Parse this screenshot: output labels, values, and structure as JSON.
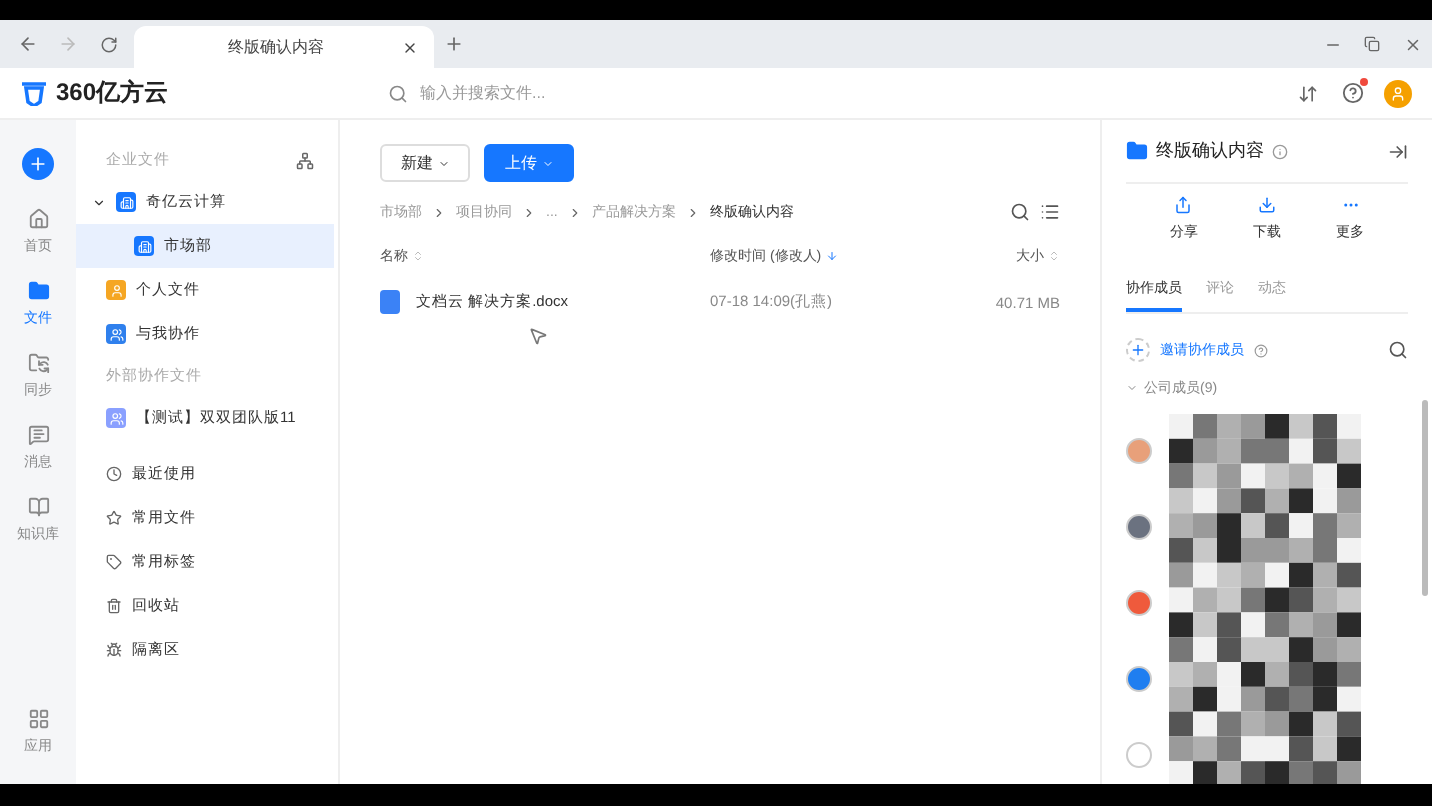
{
  "browser": {
    "tab_title": "终版确认内容"
  },
  "header": {
    "logo": "360亿方云",
    "search": {
      "placeholder": "输入并搜索文件..."
    }
  },
  "rail": [
    {
      "label": "首页",
      "selected": false
    },
    {
      "label": "文件",
      "selected": true
    },
    {
      "label": "同步",
      "selected": false
    },
    {
      "label": "消息",
      "selected": false
    },
    {
      "label": "知识库",
      "selected": false
    }
  ],
  "rail_bottom": {
    "label": "应用"
  },
  "sidebar": {
    "section_title": "企业文件",
    "tree": [
      {
        "label": "奇亿云计算",
        "expanded": true,
        "selected": false,
        "children": [
          {
            "label": "市场部",
            "selected": true
          }
        ]
      }
    ],
    "items": [
      {
        "label": "个人文件",
        "color": "#f5a623"
      },
      {
        "label": "与我协作",
        "color": "#2f80ed"
      }
    ],
    "external_title": "外部协作文件",
    "external_items": [
      {
        "label": "【测试】双双团队版11"
      }
    ],
    "links": [
      {
        "label": "最近使用"
      },
      {
        "label": "常用文件"
      },
      {
        "label": "常用标签"
      },
      {
        "label": "回收站"
      },
      {
        "label": "隔离区"
      }
    ]
  },
  "toolbar": {
    "new_button": "新建",
    "upload_button": "上传"
  },
  "breadcrumbs": [
    "市场部",
    "项目协同",
    "...",
    "产品解决方案",
    "终版确认内容"
  ],
  "table": {
    "columns": [
      {
        "label": "名称",
        "sorted": false
      },
      {
        "label": "修改时间 (修改人)",
        "sorted": true
      },
      {
        "label": "大小",
        "sorted": false
      }
    ],
    "rows": [
      {
        "name": "文档云 解决方案.docx",
        "modified": "07-18 14:09(孔燕)",
        "size": "40.71 MB"
      }
    ]
  },
  "detail": {
    "title": "终版确认内容",
    "actions": [
      {
        "label": "分享"
      },
      {
        "label": "下载"
      },
      {
        "label": "更多"
      }
    ],
    "tabs": [
      {
        "label": "协作成员",
        "selected": true
      },
      {
        "label": "评论",
        "selected": false
      },
      {
        "label": "动态",
        "selected": false
      }
    ],
    "invite": "邀请协作成员",
    "group": "公司成员(9)",
    "members": [
      {
        "color": "#e8a07a"
      },
      {
        "color": "#6b7280"
      },
      {
        "color": "#ef5a3c"
      },
      {
        "color": "#1f7ef0"
      },
      {
        "color": "#ffffff"
      }
    ]
  }
}
